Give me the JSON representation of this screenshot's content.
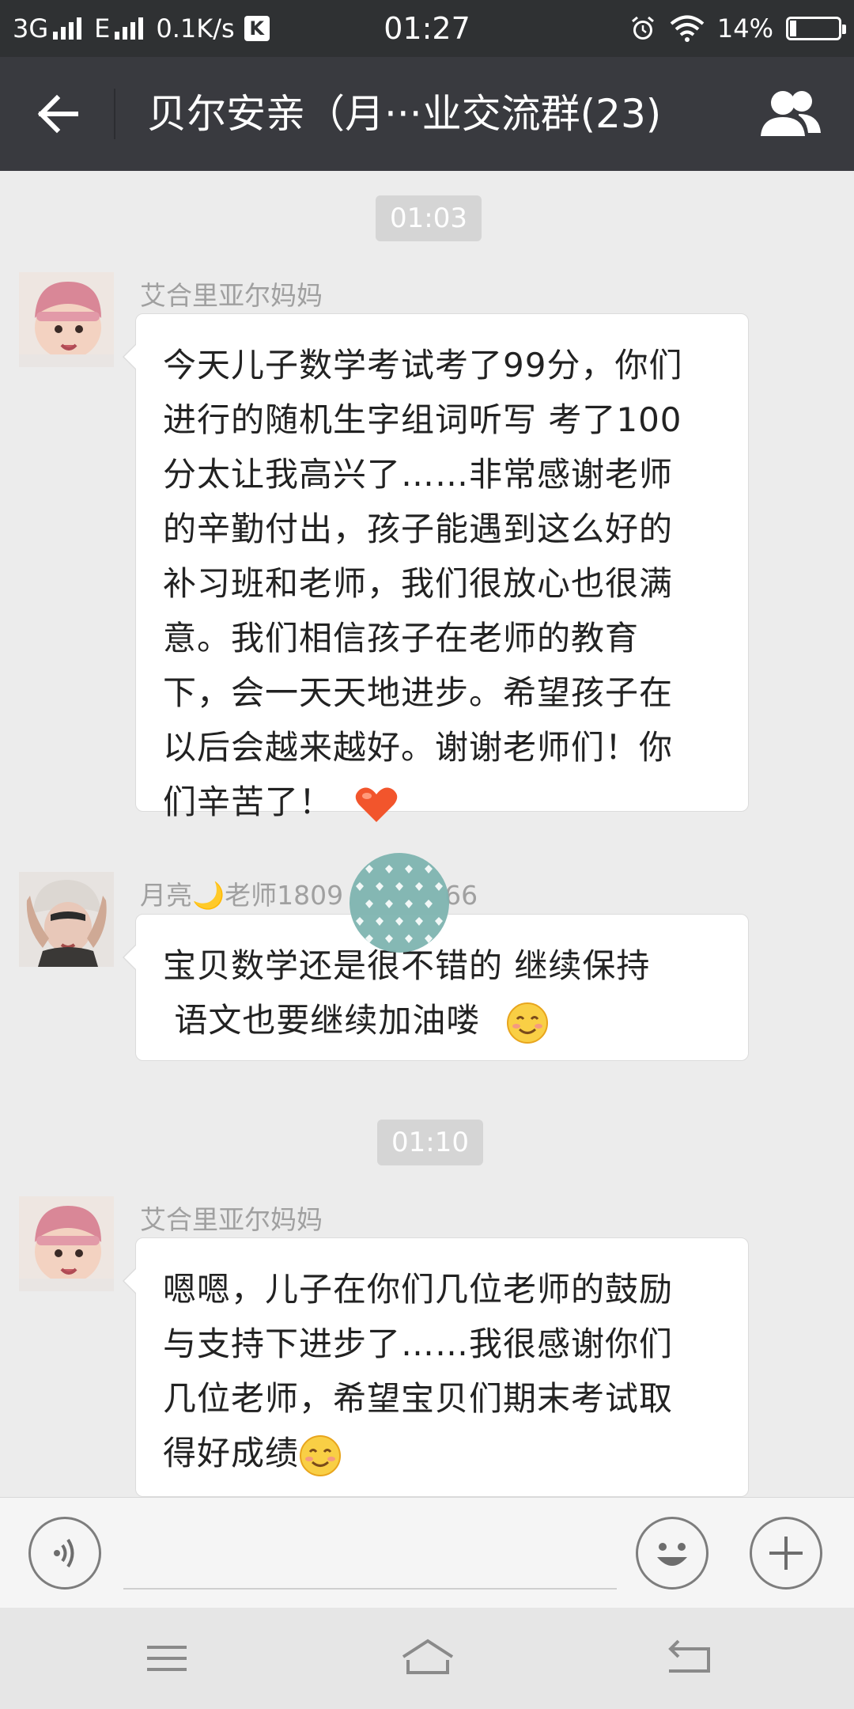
{
  "status_bar": {
    "network_1": "3G",
    "network_2": "E",
    "speed": "0.1K/s",
    "k_badge": "K",
    "time": "01:27",
    "battery": "14%",
    "battery_level": 0.14,
    "icons": [
      "signal-icon",
      "alarm-icon",
      "wifi-icon",
      "battery-icon"
    ]
  },
  "header": {
    "title": "贝尔安亲（月···业交流群(23)",
    "back_icon": "arrow-left-icon",
    "members_icon": "group-members-icon"
  },
  "chat": {
    "time_1": "01:03",
    "time_2": "01:10",
    "messages": [
      {
        "sender": "艾合里亚尔妈妈",
        "lines": [
          "今天儿子数学考试考了99分，你们",
          "进行的随机生字组词听写 考了100",
          "分太让我高兴了……非常感谢老师",
          "的辛勤付出，孩子能遇到这么好的",
          "补习班和老师，我们很放心也很满",
          "意。我们相信孩子在老师的教育",
          "下，会一天天地进步。希望孩子在",
          "以后会越来越好。谢谢老师们！你",
          "们辛苦了！"
        ],
        "emoji": "heart-emoji"
      },
      {
        "sender": "月亮🌙老师1809",
        "sender_tail": "66",
        "lines": [
          "宝贝数学还是很不错的  继续保持",
          " 语文也要继续加油喽 "
        ],
        "emoji": "smile-emoji"
      },
      {
        "sender": "艾合里亚尔妈妈",
        "lines": [
          "嗯嗯，儿子在你们几位老师的鼓励",
          "与支持下进步了……我很感谢你们",
          "几位老师，希望宝贝们期末考试取",
          "得好成绩"
        ],
        "emoji": "smile-emoji"
      }
    ]
  },
  "input_bar": {
    "voice_icon": "voice-icon",
    "emoji_icon": "emoji-face-icon",
    "plus_icon": "plus-icon"
  },
  "nav_bar": {
    "icons": [
      "menu-icon",
      "home-icon",
      "back-nav-icon"
    ]
  }
}
